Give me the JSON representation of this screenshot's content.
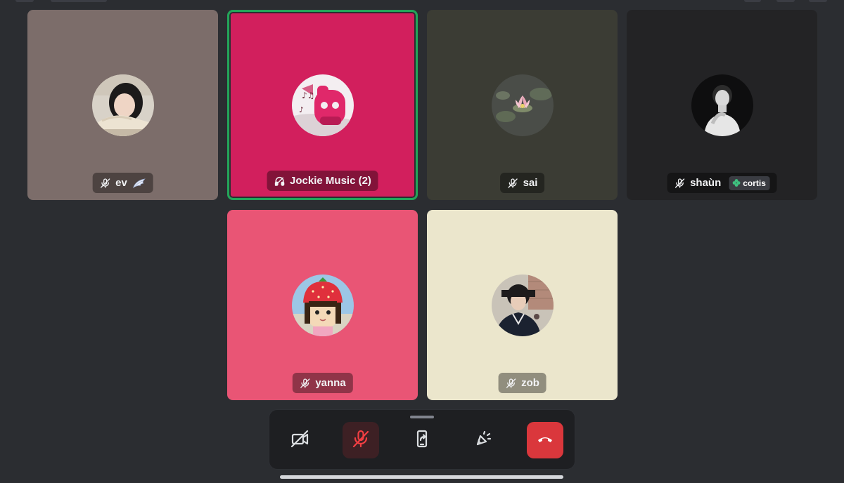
{
  "call": {
    "participants": [
      {
        "name": "ev",
        "muted": true,
        "tile_color": "#7c6d6a",
        "speaking": false
      },
      {
        "name": "Jockie Music (2)",
        "muted": false,
        "tile_color": "#d21f5d",
        "speaking": true,
        "chip_icon": "headphones-icon"
      },
      {
        "name": "sai",
        "muted": true,
        "tile_color": "#3b3c34",
        "speaking": false
      },
      {
        "name": "shaùn",
        "muted": true,
        "tile_color": "#232325",
        "speaking": false,
        "tag": "cortis"
      },
      {
        "name": "yanna",
        "muted": true,
        "tile_color": "#e95575",
        "speaking": false
      },
      {
        "name": "zob",
        "muted": true,
        "tile_color": "#ebe6cc",
        "speaking": false
      }
    ],
    "speaking_color": "#23a559"
  },
  "controls": {
    "buttons": [
      {
        "icon": "camera-off-icon",
        "state": "off"
      },
      {
        "icon": "microphone-muted-icon",
        "state": "muted",
        "color": "#da373c"
      },
      {
        "icon": "share-screen-icon",
        "state": "idle"
      },
      {
        "icon": "soundboard-icon",
        "state": "idle"
      },
      {
        "icon": "hang-up-icon",
        "state": "idle",
        "color": "#da373c"
      }
    ]
  }
}
